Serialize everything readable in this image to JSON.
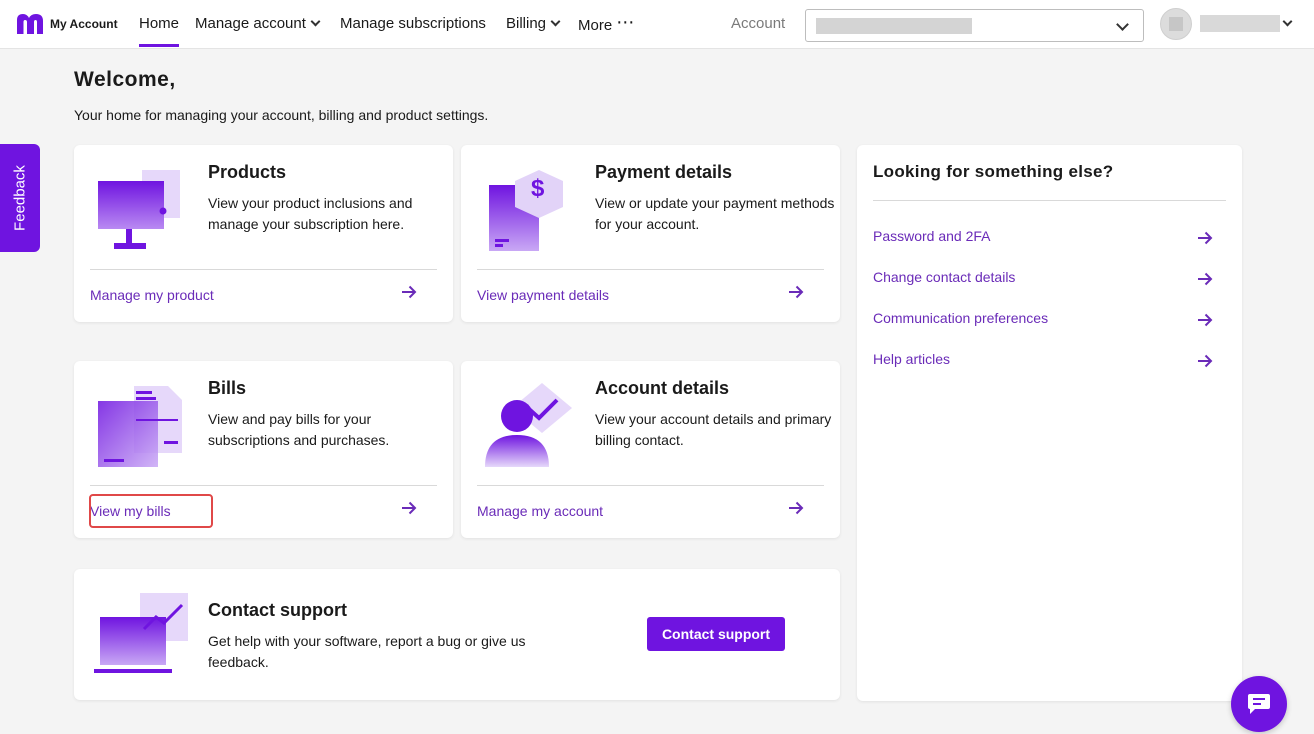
{
  "app": {
    "logo_text": "My Account"
  },
  "nav": {
    "items": [
      {
        "label": "Home",
        "active": true
      },
      {
        "label": "Manage account",
        "dropdown": true
      },
      {
        "label": "Manage subscriptions"
      },
      {
        "label": "Billing",
        "dropdown": true
      },
      {
        "label": "More"
      }
    ],
    "account_label": "Account"
  },
  "page": {
    "welcome": "Welcome,",
    "subtitle": "Your home for managing your account, billing and product settings."
  },
  "feedback": {
    "label": "Feedback"
  },
  "cards": {
    "products": {
      "title": "Products",
      "description": "View your product inclusions and manage your subscription here.",
      "link": "Manage my product"
    },
    "payment": {
      "title": "Payment details",
      "description": "View or update your payment methods for your account.",
      "link": "View payment details",
      "illustration_symbol": "$"
    },
    "bills": {
      "title": "Bills",
      "description": "View and pay bills for your subscriptions and purchases.",
      "link": "View my bills",
      "highlighted": true
    },
    "account": {
      "title": "Account details",
      "description": "View your account details and primary billing contact.",
      "link": "Manage my account"
    },
    "support": {
      "title": "Contact support",
      "description": "Get help with your software, report a bug or give us feedback.",
      "button": "Contact support"
    }
  },
  "side_panel": {
    "title": "Looking for something else?",
    "links": [
      {
        "label": "Password and 2FA"
      },
      {
        "label": "Change contact details"
      },
      {
        "label": "Communication preferences"
      },
      {
        "label": "Help articles"
      }
    ]
  },
  "colors": {
    "brand": "#6f14e0",
    "link": "#6a2bb8",
    "highlight": "#e04848",
    "background": "#f4f4f4"
  },
  "icons": {
    "arrow": "arrow-right-icon",
    "chat": "chat-bubble-icon",
    "dropdown": "chevron-down-icon",
    "more": "more-dots-icon"
  }
}
